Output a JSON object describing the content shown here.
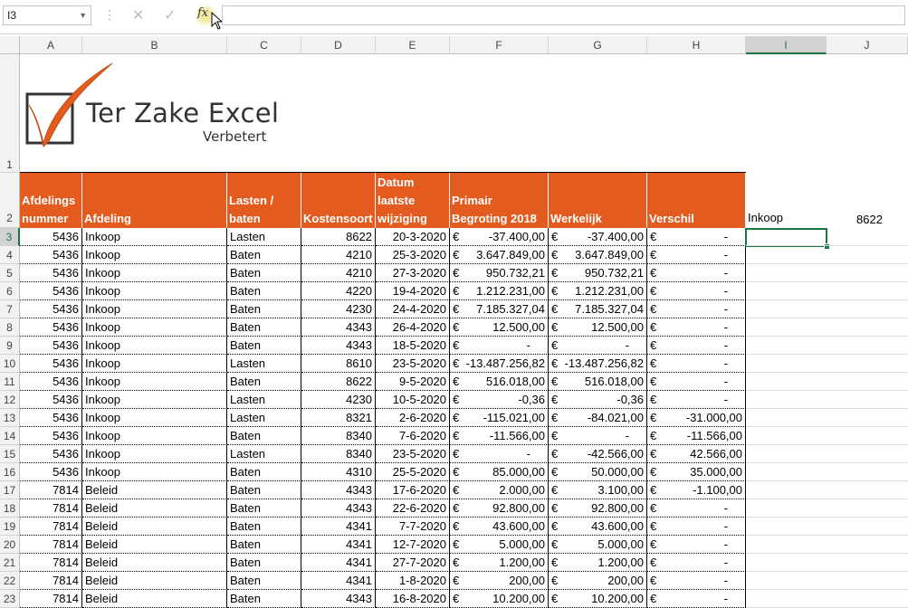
{
  "formula_bar": {
    "name_box": "I3",
    "formula": ""
  },
  "columns": [
    "A",
    "B",
    "C",
    "D",
    "E",
    "F",
    "G",
    "H",
    "I",
    "J"
  ],
  "selected_column": "I",
  "row_numbers": [
    "1",
    "2",
    "3",
    "4",
    "5",
    "6",
    "7",
    "8",
    "9",
    "10",
    "11",
    "12",
    "13",
    "14",
    "15",
    "16",
    "17",
    "18",
    "19",
    "20",
    "21",
    "22",
    "23"
  ],
  "selected_row": "3",
  "logo": {
    "title": "Ter Zake Excel",
    "subtitle": "Verbetert"
  },
  "headers": [
    "Afdelings\nnummer",
    "Afdeling",
    "Lasten /\nbaten",
    "Kostensoort",
    "Datum\nlaatste\nwijziging",
    "Primair\nBegroting 2018",
    "Werkelijk",
    "Verschil"
  ],
  "side_cells": {
    "i2": "Inkoop",
    "j2": "8622"
  },
  "rows": [
    [
      "5436",
      "Inkoop",
      "Lasten",
      "8622",
      "20-3-2020",
      "-37.400,00",
      "-37.400,00",
      "-"
    ],
    [
      "5436",
      "Inkoop",
      "Baten",
      "4210",
      "25-3-2020",
      "3.647.849,00",
      "3.647.849,00",
      "-"
    ],
    [
      "5436",
      "Inkoop",
      "Baten",
      "4210",
      "27-3-2020",
      "950.732,21",
      "950.732,21",
      "-"
    ],
    [
      "5436",
      "Inkoop",
      "Baten",
      "4220",
      "19-4-2020",
      "1.212.231,00",
      "1.212.231,00",
      "-"
    ],
    [
      "5436",
      "Inkoop",
      "Baten",
      "4230",
      "24-4-2020",
      "7.185.327,04",
      "7.185.327,04",
      "-"
    ],
    [
      "5436",
      "Inkoop",
      "Baten",
      "4343",
      "26-4-2020",
      "12.500,00",
      "12.500,00",
      "-"
    ],
    [
      "5436",
      "Inkoop",
      "Baten",
      "4343",
      "18-5-2020",
      "-",
      "-",
      "-"
    ],
    [
      "5436",
      "Inkoop",
      "Lasten",
      "8610",
      "23-5-2020",
      "-13.487.256,82",
      "-13.487.256,82",
      "-"
    ],
    [
      "5436",
      "Inkoop",
      "Baten",
      "8622",
      "9-5-2020",
      "516.018,00",
      "516.018,00",
      "-"
    ],
    [
      "5436",
      "Inkoop",
      "Lasten",
      "4230",
      "10-5-2020",
      "-0,36",
      "-0,36",
      "-"
    ],
    [
      "5436",
      "Inkoop",
      "Lasten",
      "8321",
      "2-6-2020",
      "-115.021,00",
      "-84.021,00",
      "-31.000,00"
    ],
    [
      "5436",
      "Inkoop",
      "Baten",
      "8340",
      "7-6-2020",
      "-11.566,00",
      "-",
      "-11.566,00"
    ],
    [
      "5436",
      "Inkoop",
      "Lasten",
      "8340",
      "23-5-2020",
      "-",
      "-42.566,00",
      "42.566,00"
    ],
    [
      "5436",
      "Inkoop",
      "Baten",
      "4310",
      "25-5-2020",
      "85.000,00",
      "50.000,00",
      "35.000,00"
    ],
    [
      "7814",
      "Beleid",
      "Baten",
      "4343",
      "17-6-2020",
      "2.000,00",
      "3.100,00",
      "-1.100,00"
    ],
    [
      "7814",
      "Beleid",
      "Baten",
      "4343",
      "22-6-2020",
      "92.800,00",
      "92.800,00",
      "-"
    ],
    [
      "7814",
      "Beleid",
      "Baten",
      "4341",
      "7-7-2020",
      "43.600,00",
      "43.600,00",
      "-"
    ],
    [
      "7814",
      "Beleid",
      "Baten",
      "4341",
      "12-7-2020",
      "5.000,00",
      "5.000,00",
      "-"
    ],
    [
      "7814",
      "Beleid",
      "Baten",
      "4341",
      "27-7-2020",
      "1.200,00",
      "1.200,00",
      "-"
    ],
    [
      "7814",
      "Beleid",
      "Baten",
      "4341",
      "1-8-2020",
      "200,00",
      "200,00",
      "-"
    ],
    [
      "7814",
      "Beleid",
      "Baten",
      "4343",
      "16-8-2020",
      "10.200,00",
      "10.200,00",
      "-"
    ]
  ],
  "currency_symbol": "€"
}
